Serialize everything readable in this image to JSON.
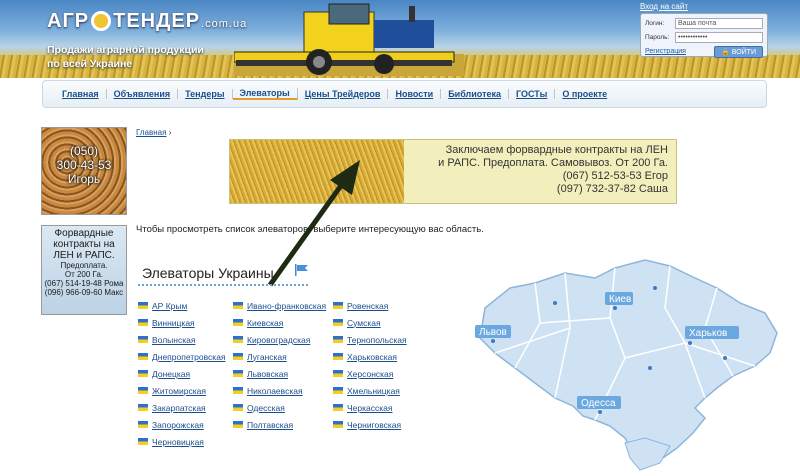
{
  "header": {
    "logo_left": "АГР",
    "logo_right": "ТЕНДЕР",
    "logo_domain": ".com.ua",
    "tagline": "Продажи аграрной продукции по всей Украине"
  },
  "login": {
    "title": "Вход на сайт",
    "login_label": "Логин:",
    "login_value": "Ваша почта",
    "password_label": "Пароль:",
    "password_value": "••••••••••••",
    "register": "Регистрация",
    "submit": "ВОЙТИ"
  },
  "nav": [
    "Главная",
    "Объявления",
    "Тендеры",
    "Элеваторы",
    "Цены Трейдеров",
    "Новости",
    "Библиотека",
    "ГОСТы",
    "О проекте"
  ],
  "nav_active": "Элеваторы",
  "ad1": {
    "line1": "(050)",
    "line2": "300-43-53",
    "line3": "Игорь"
  },
  "ad2": {
    "line1": "Форвардные",
    "line2": "контракты на",
    "line3": "ЛЕН и РАПС.",
    "line4": "Предоплата.",
    "line5": "От 200 Га.",
    "line6": "(067) 514-19-48 Рома",
    "line7": "(096) 966-09-60 Макс"
  },
  "breadcrumb": {
    "home": "Главная",
    "sep": "›"
  },
  "banner": {
    "line1": "Заключаем форвардные контракты на ЛЕН",
    "line2": "и РАПС. Предоплата. Самовывоз. От 200 Га.",
    "line3": "(067) 512-53-53 Егор",
    "line4": "(097) 732-37-82 Саша"
  },
  "intro": "Чтобы просмотреть список элеваторов, выберите интересующую вас область.",
  "heading": "Элеваторы Украины",
  "regions": {
    "col1": [
      "АР Крым",
      "Винницкая",
      "Волынская",
      "Днепропетровская",
      "Донецкая",
      "Житомирская",
      "Закарпатская",
      "Запорожская",
      "Черновицкая"
    ],
    "col2": [
      "Ивано-франковская",
      "Киевская",
      "Кировоградская",
      "Луганская",
      "Львовская",
      "Николаевская",
      "Одесская",
      "Полтавская"
    ],
    "col3": [
      "Ровенская",
      "Сумская",
      "Тернопольская",
      "Харьковская",
      "Херсонская",
      "Хмельницкая",
      "Черкасская",
      "Черниговская"
    ]
  },
  "map_labels": {
    "kiev": "Киев",
    "lviv": "Львов",
    "kharkiv": "Харьков",
    "odessa": "Одесса"
  },
  "colors": {
    "link": "#1b4e8c",
    "accent": "#e59a2b",
    "map_fill": "#cfe2f3",
    "map_border": "#ffffff",
    "map_label": "#5b9bd5"
  }
}
